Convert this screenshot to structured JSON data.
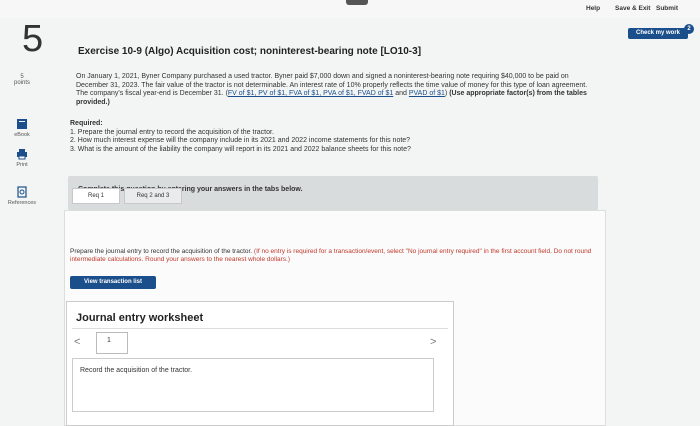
{
  "topbar": {
    "help_label": "Help",
    "save_exit_label": "Save & Exit",
    "submit_label": "Submit"
  },
  "check_work": {
    "label": "Check my work",
    "badge": "2"
  },
  "question": {
    "number": "5"
  },
  "sidebar": {
    "points_value": "5",
    "points_label": "points",
    "items": [
      {
        "label": "eBook",
        "icon": "book-icon"
      },
      {
        "label": "Print",
        "icon": "print-icon"
      },
      {
        "label": "References",
        "icon": "references-icon"
      }
    ]
  },
  "exercise": {
    "title": "Exercise 10-9 (Algo) Acquisition cost; noninterest-bearing note [LO10-3]",
    "paragraph_1": "On January 1, 2021, Byner Company purchased a used tractor. Byner paid $7,000 down and signed a noninterest-bearing note requiring $40,000 to be paid on December 31, 2023. The fair value of the tractor is not determinable. An interest rate of 10% properly reflects the time value of money for this type of loan agreement. The company's fiscal year-end is December 31. (",
    "links_1": "FV of $1, PV of $1, FVA of $1, PVA of $1, FVAD of $1",
    "and_text": " and ",
    "links_2": "PVAD of $1",
    "paragraph_2": ") ",
    "paragraph_bold": "(Use appropriate factor(s) from the tables provided.)",
    "required_label": "Required:",
    "required_1": "1. Prepare the journal entry to record the acquisition of the tractor.",
    "required_2": "2. How much interest expense will the company include in its 2021 and 2022 income statements for this note?",
    "required_3": "3. What is the amount of the liability the company will report in its 2021 and 2022 balance sheets for this note?"
  },
  "answer_panel": {
    "instruction": "Complete this question by entering your answers in the tabs below.",
    "tabs": [
      {
        "label": "Req 1"
      },
      {
        "label": "Req 2 and 3"
      }
    ]
  },
  "content": {
    "instruction_main": "Prepare the journal entry to record the acquisition of the tractor. ",
    "instruction_note": "(If no entry is required for a transaction/event, select \"No journal entry required\" in the first account field. Do not round intermediate calculations. Round your answers to the nearest whole dollars.)",
    "view_transaction_label": "View transaction list"
  },
  "journal": {
    "title": "Journal entry worksheet",
    "page": "1",
    "description": "Record the acquisition of the tractor."
  },
  "colors": {
    "accent": "#1a4f8b",
    "note_red": "#c0392b"
  }
}
